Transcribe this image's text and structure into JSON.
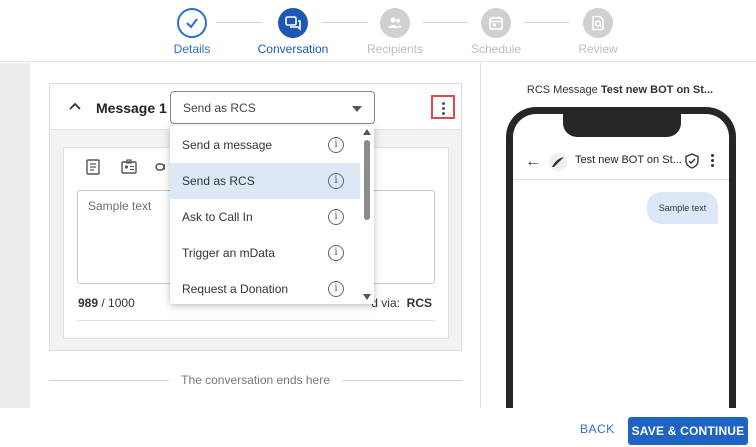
{
  "stepper": {
    "steps": [
      {
        "label": "Details",
        "state": "done",
        "icon": "check-icon"
      },
      {
        "label": "Conversation",
        "state": "active",
        "icon": "chat-icon"
      },
      {
        "label": "Recipients",
        "state": "pending",
        "icon": "group-icon"
      },
      {
        "label": "Schedule",
        "state": "pending",
        "icon": "calendar-icon"
      },
      {
        "label": "Review",
        "state": "pending",
        "icon": "review-icon"
      }
    ]
  },
  "message": {
    "title": "Message 1",
    "channel_value": "Send as RCS",
    "textarea_placeholder": "Sample text",
    "char_used": "989",
    "char_limit": "/ 1000",
    "send_via_label": "d via:",
    "send_via_value": "RCS"
  },
  "dropdown": {
    "options": [
      {
        "label": "Send a message",
        "selected": false
      },
      {
        "label": "Send as RCS",
        "selected": true
      },
      {
        "label": "Ask to Call In",
        "selected": false
      },
      {
        "label": "Trigger an mData",
        "selected": false
      },
      {
        "label": "Request a Donation",
        "selected": false
      }
    ],
    "info_glyph": "i"
  },
  "conversation_end": "The conversation ends here",
  "preview": {
    "prefix": "RCS Message",
    "bot_name_bold": "Test new BOT on St...",
    "header_name": "Test new BOT on St...",
    "bubble_text": "Sample text"
  },
  "footer": {
    "back_label": "BACK",
    "save_label": "SAVE & CONTINUE"
  },
  "colors": {
    "primary": "#1f63c4",
    "active_step": "#1d58b5",
    "pending_step": "#d0d0d0",
    "selected_option": "#dde8f7",
    "highlight_border": "#e04a4a"
  }
}
